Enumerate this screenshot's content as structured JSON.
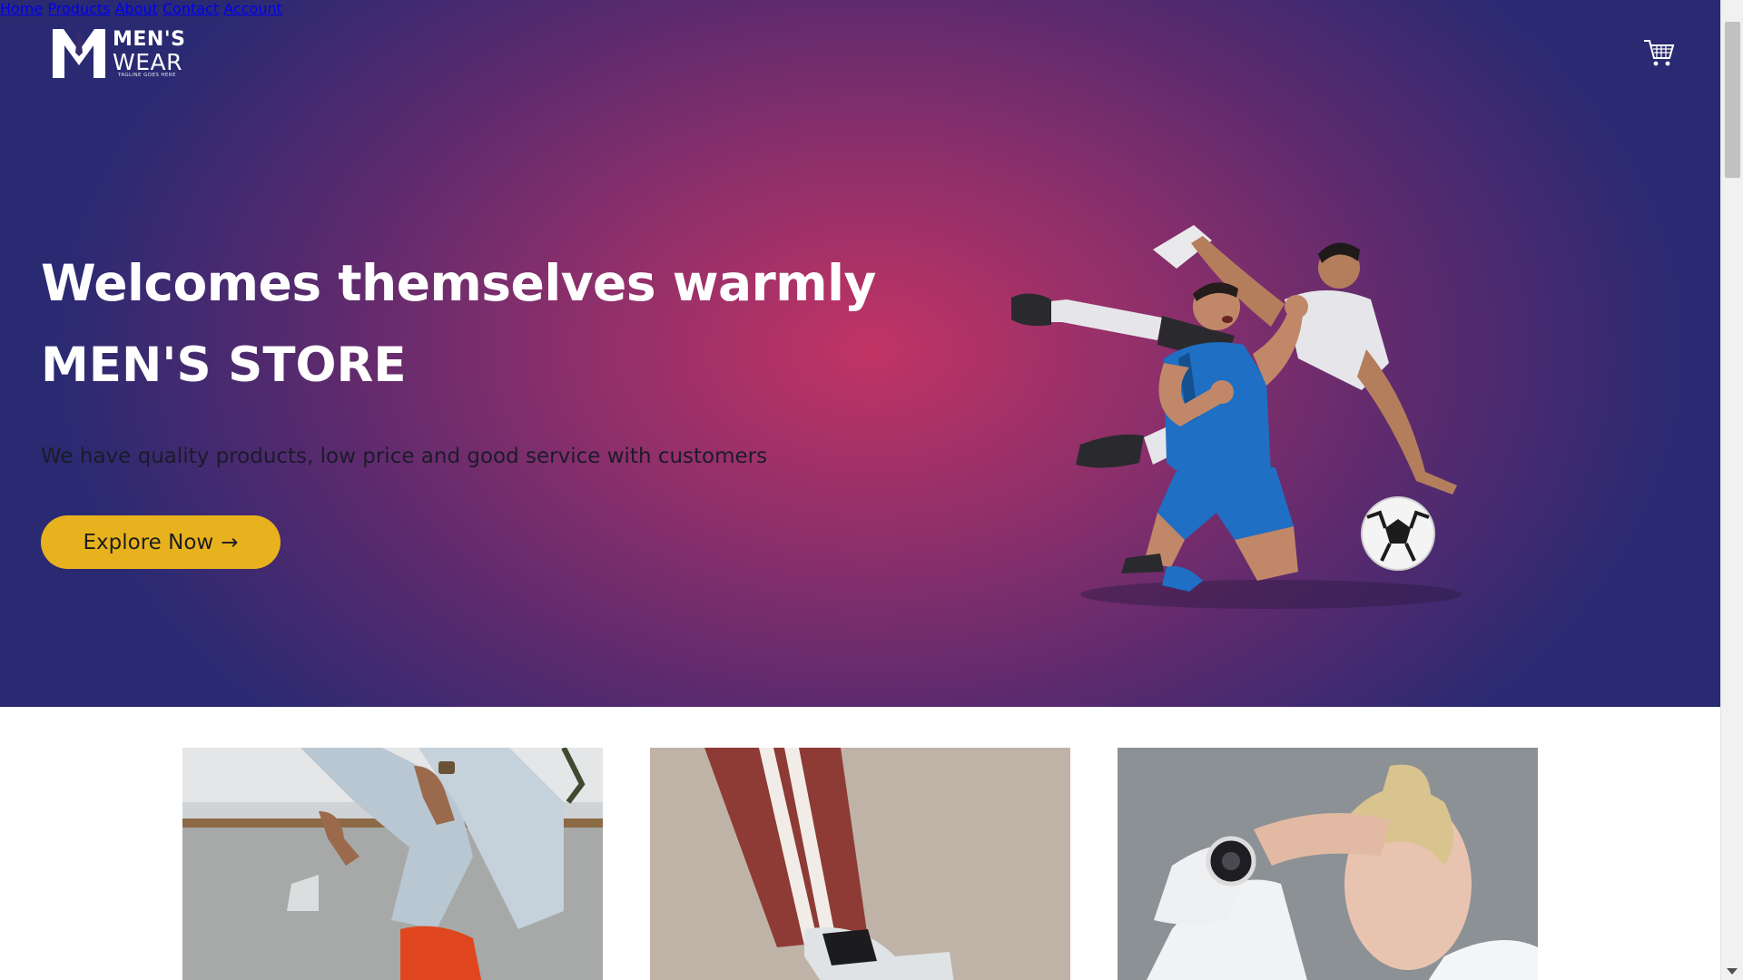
{
  "brand": {
    "name_line1": "MEN'S",
    "name_line2": "WEAR",
    "tagline": "TAGLINE GOES HERE"
  },
  "nav": {
    "items": [
      "Home",
      "Products",
      "About",
      "Contact",
      "Account"
    ],
    "cart_icon": "cart-icon"
  },
  "hero": {
    "headline": "Welcomes themselves warmly",
    "store_name": "MEN'S STORE",
    "subtitle": "We have quality products, low price and good service with customers",
    "cta_label": "Explore Now",
    "cta_arrow": "→"
  },
  "colors": {
    "hero_center": "#c13464",
    "hero_edge": "#2a2a72",
    "cta_bg": "#e8b21e",
    "text_light": "#ffffff"
  },
  "products": {
    "cards": [
      {
        "image": "jeans-and-red-sneakers-photo"
      },
      {
        "image": "track-pants-and-sneaker-photo"
      },
      {
        "image": "woman-with-smartwatch-photo"
      }
    ]
  }
}
